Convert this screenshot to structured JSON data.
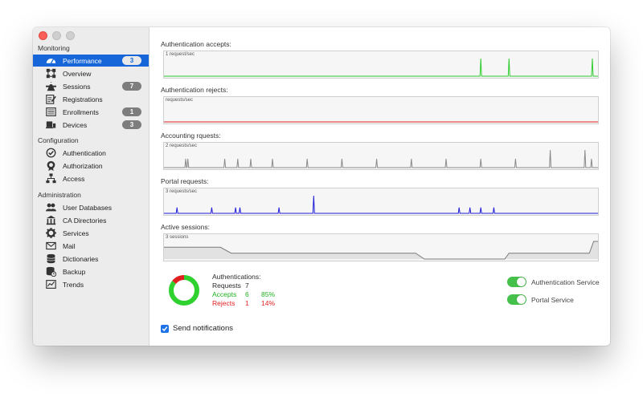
{
  "sidebar": {
    "sections": [
      {
        "title": "Monitoring",
        "items": [
          {
            "label": "Performance",
            "icon": "gauge-icon",
            "badge": "3",
            "active": true
          },
          {
            "label": "Overview",
            "icon": "network-icon",
            "badge": ""
          },
          {
            "label": "Sessions",
            "icon": "people-icon",
            "badge": "7"
          },
          {
            "label": "Registrations",
            "icon": "edit-icon",
            "badge": ""
          },
          {
            "label": "Enrollments",
            "icon": "list-icon",
            "badge": "1"
          },
          {
            "label": "Devices",
            "icon": "devices-icon",
            "badge": "3"
          }
        ]
      },
      {
        "title": "Configuration",
        "items": [
          {
            "label": "Authentication",
            "icon": "check-circle-icon",
            "badge": ""
          },
          {
            "label": "Authorization",
            "icon": "badge-icon",
            "badge": ""
          },
          {
            "label": "Access",
            "icon": "hierarchy-icon",
            "badge": ""
          }
        ]
      },
      {
        "title": "Administration",
        "items": [
          {
            "label": "User Databases",
            "icon": "users-icon",
            "badge": ""
          },
          {
            "label": "CA Directories",
            "icon": "bank-icon",
            "badge": ""
          },
          {
            "label": "Services",
            "icon": "gear-icon",
            "badge": ""
          },
          {
            "label": "Mail",
            "icon": "mail-icon",
            "badge": ""
          },
          {
            "label": "Dictionaries",
            "icon": "book-icon",
            "badge": ""
          },
          {
            "label": "Backup",
            "icon": "database-icon",
            "badge": ""
          },
          {
            "label": "Trends",
            "icon": "trend-chart-icon",
            "badge": ""
          }
        ]
      }
    ]
  },
  "graphs": [
    {
      "label": "Authentication accepts:",
      "caption": "1 request/sec",
      "color": "#2ecc2e",
      "type": "spikes",
      "spikes": [
        {
          "x": 0.73,
          "h": 1
        },
        {
          "x": 0.795,
          "h": 1
        },
        {
          "x": 0.987,
          "h": 1
        }
      ]
    },
    {
      "label": "Authentication rejects:",
      "caption": "requests/sec",
      "color": "#e02020",
      "type": "spikes",
      "spikes": []
    },
    {
      "label": "Accounting rquests:",
      "caption": "2 requests/sec",
      "color": "#8a8a8a",
      "type": "spikes",
      "spikes": [
        {
          "x": 0.05,
          "h": 0.5
        },
        {
          "x": 0.055,
          "h": 0.5
        },
        {
          "x": 0.14,
          "h": 0.5
        },
        {
          "x": 0.17,
          "h": 0.5
        },
        {
          "x": 0.2,
          "h": 0.5
        },
        {
          "x": 0.25,
          "h": 0.5
        },
        {
          "x": 0.33,
          "h": 0.5
        },
        {
          "x": 0.41,
          "h": 0.5
        },
        {
          "x": 0.49,
          "h": 0.5
        },
        {
          "x": 0.57,
          "h": 0.5
        },
        {
          "x": 0.65,
          "h": 0.5
        },
        {
          "x": 0.73,
          "h": 0.5
        },
        {
          "x": 0.81,
          "h": 0.5
        },
        {
          "x": 0.89,
          "h": 1
        },
        {
          "x": 0.97,
          "h": 1
        },
        {
          "x": 0.985,
          "h": 0.5
        }
      ]
    },
    {
      "label": "Portal requests:",
      "caption": "3 requests/sec",
      "color": "#2020d8",
      "type": "spikes",
      "spikes": [
        {
          "x": 0.03,
          "h": 0.33
        },
        {
          "x": 0.11,
          "h": 0.33
        },
        {
          "x": 0.165,
          "h": 0.33
        },
        {
          "x": 0.175,
          "h": 0.33
        },
        {
          "x": 0.265,
          "h": 0.33
        },
        {
          "x": 0.345,
          "h": 1
        },
        {
          "x": 0.68,
          "h": 0.33
        },
        {
          "x": 0.705,
          "h": 0.33
        },
        {
          "x": 0.73,
          "h": 0.33
        },
        {
          "x": 0.76,
          "h": 0.33
        }
      ]
    },
    {
      "label": "Active sessions:",
      "caption": "3 sessions",
      "color": "#7a7a7a",
      "type": "step",
      "points": [
        {
          "x": 0,
          "v": 0.67
        },
        {
          "x": 0.13,
          "v": 0.67
        },
        {
          "x": 0.155,
          "v": 0.33
        },
        {
          "x": 0.58,
          "v": 0.33
        },
        {
          "x": 0.6,
          "v": 0
        },
        {
          "x": 0.785,
          "v": 0
        },
        {
          "x": 0.795,
          "v": 0.33
        },
        {
          "x": 0.98,
          "v": 0.33
        },
        {
          "x": 0.99,
          "v": 1
        },
        {
          "x": 1,
          "v": 1
        }
      ]
    }
  ],
  "summary": {
    "title": "Authentications:",
    "requests_label": "Requests",
    "requests_value": "7",
    "accepts_label": "Accepts",
    "accepts_value": "6",
    "accepts_pct": "85%",
    "rejects_label": "Rejects",
    "rejects_value": "1",
    "rejects_pct": "14%",
    "accept_fraction": 0.857,
    "accept_color": "#2fd12f",
    "reject_color": "#e02020"
  },
  "services": [
    {
      "label": "Authentication Service",
      "on": true
    },
    {
      "label": "Portal Service",
      "on": true
    }
  ],
  "notifications": {
    "label": "Send notifications",
    "checked": true
  }
}
